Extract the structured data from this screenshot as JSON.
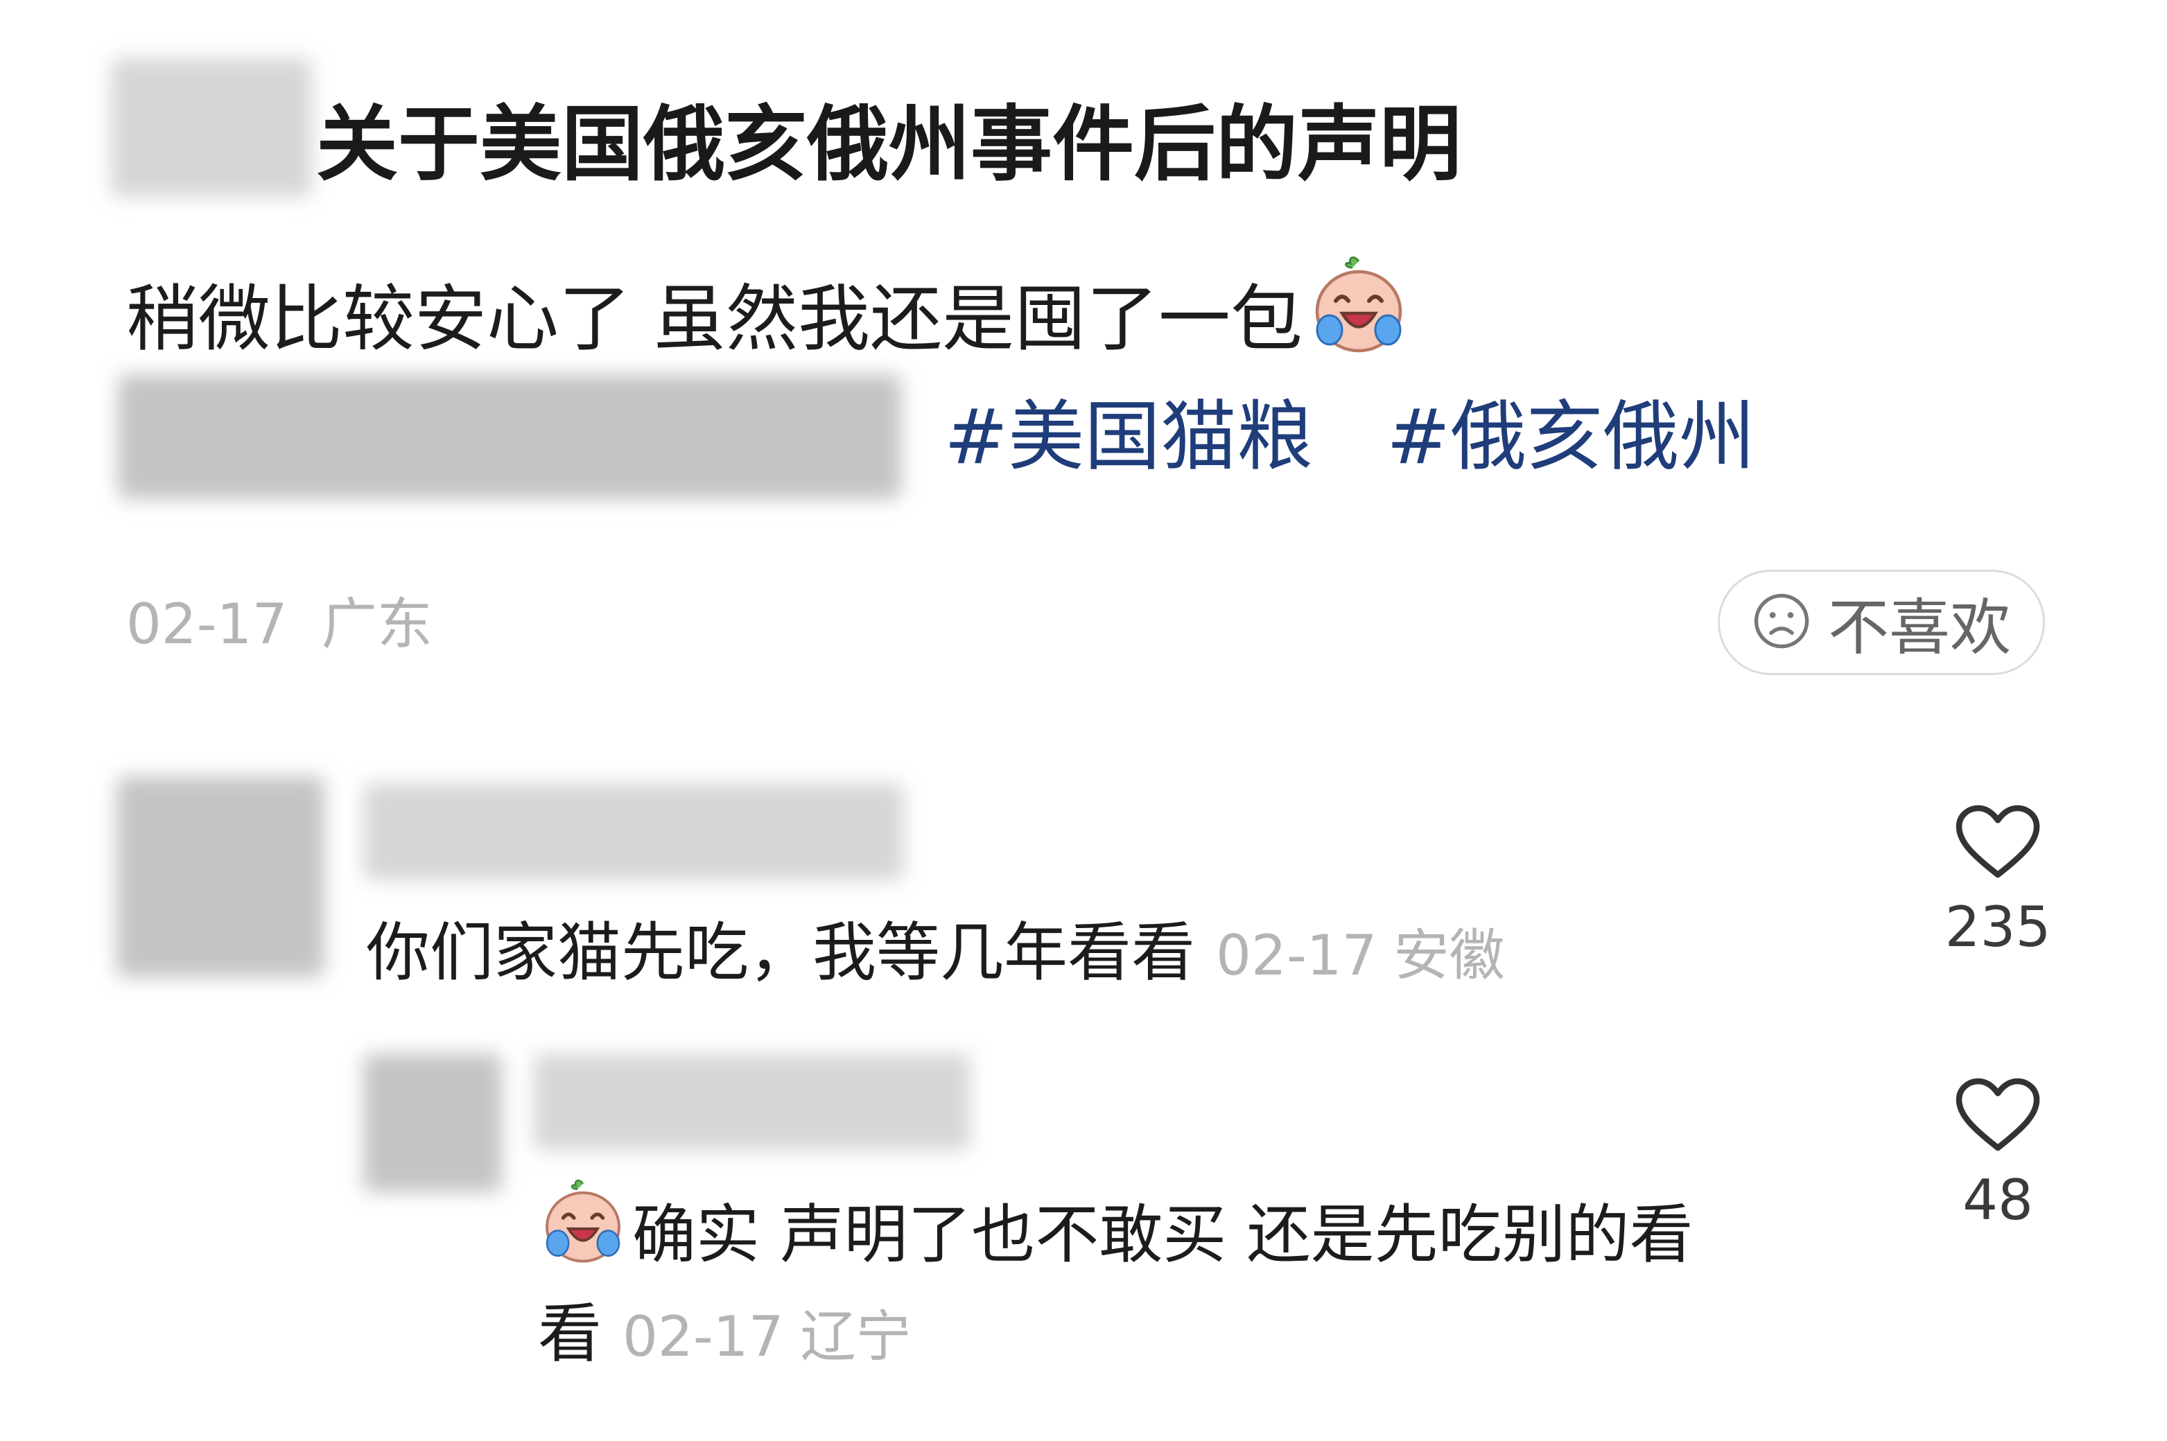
{
  "post": {
    "title": "关于美国俄亥俄州事件后的声明",
    "body": "稍微比较安心了 虽然我还是囤了一包",
    "hashtags": [
      "#美国猫粮",
      "#俄亥俄州"
    ],
    "date": "02-17",
    "location": "广东",
    "dislike_label": "不喜欢"
  },
  "comments": [
    {
      "text": "你们家猫先吃，我等几年看看",
      "date": "02-17",
      "location": "安徽",
      "likes": "235"
    },
    {
      "line1": "确实 声明了也不敢买 还是先吃别的看",
      "line2": "看",
      "date": "02-17",
      "location": "辽宁",
      "likes": "48"
    }
  ],
  "colors": {
    "hashtag": "#1f3d7a",
    "meta": "#b4b4b4",
    "text": "#1c1c1c"
  },
  "icons": [
    "crying-laughing-emoji-icon",
    "sad-face-icon",
    "heart-outline-icon"
  ]
}
